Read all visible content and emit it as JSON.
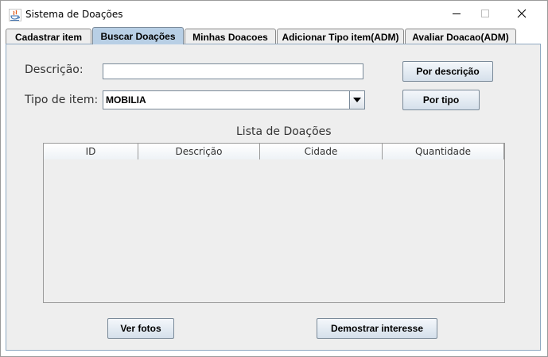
{
  "window": {
    "title": "Sistema de Doações"
  },
  "tabs": [
    {
      "label": "Cadastrar item",
      "active": false
    },
    {
      "label": "Buscar Doações",
      "active": true
    },
    {
      "label": "Minhas Doacoes",
      "active": false
    },
    {
      "label": "Adicionar Tipo item(ADM)",
      "active": false
    },
    {
      "label": "Avaliar Doacao(ADM)",
      "active": false
    }
  ],
  "search": {
    "description_label": "Descrição:",
    "description_value": "",
    "type_label": "Tipo de item:",
    "type_selected": "MOBILIA",
    "by_description_button": "Por descrição",
    "by_type_button": "Por tipo"
  },
  "table": {
    "title": "Lista de Doações",
    "columns": [
      "ID",
      "Descrição",
      "Cidade",
      "Quantidade"
    ],
    "rows": []
  },
  "actions": {
    "view_photos_button": "Ver fotos",
    "show_interest_button": "Demostrar interesse"
  }
}
